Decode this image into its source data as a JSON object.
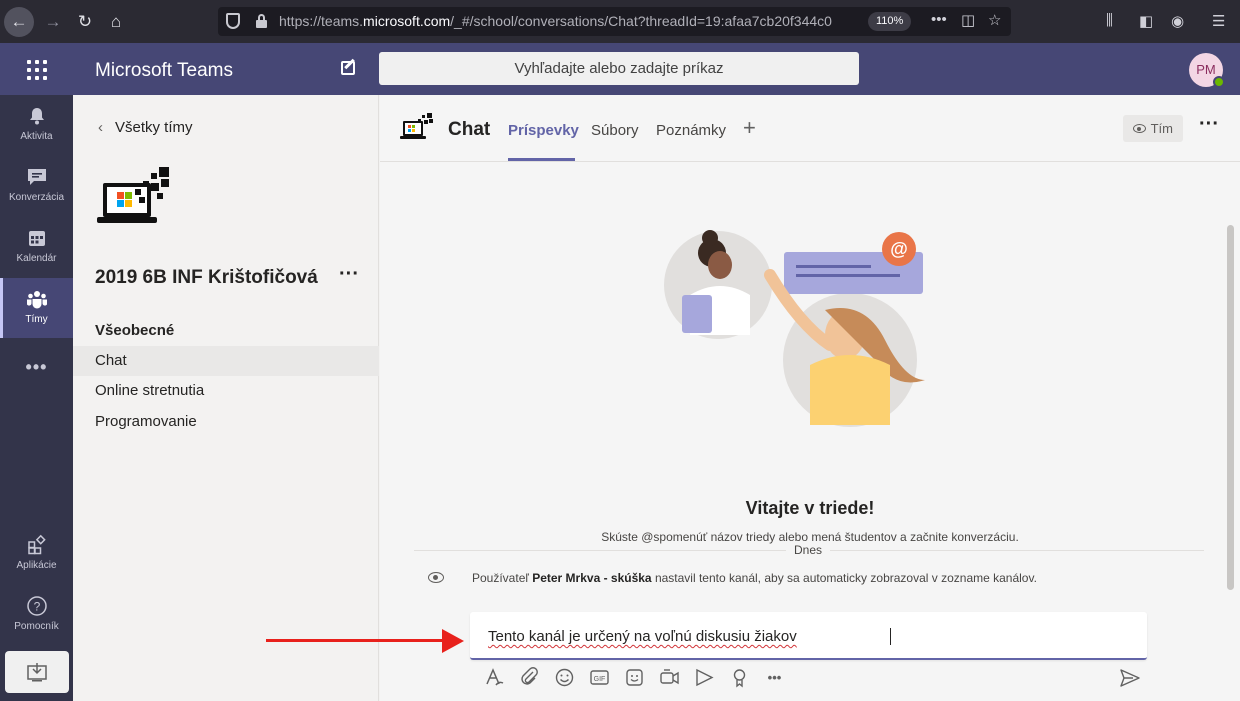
{
  "browser": {
    "url_prefix": "https://teams.",
    "url_domain": "microsoft.com",
    "url_rest": "/_#/school/conversations/Chat?threadId=19:afaa7cb20f344c0",
    "zoom": "110%"
  },
  "header": {
    "app_title": "Microsoft Teams",
    "search_placeholder": "Vyhľadajte alebo zadajte príkaz",
    "avatar_initials": "PM"
  },
  "rail": {
    "items": [
      {
        "label": "Aktivita",
        "icon": "bell-icon"
      },
      {
        "label": "Konverzácia",
        "icon": "chat-icon"
      },
      {
        "label": "Kalendár",
        "icon": "calendar-icon"
      },
      {
        "label": "Tímy",
        "icon": "teams-icon"
      },
      {
        "label": "Aplikácie",
        "icon": "apps-icon"
      },
      {
        "label": "Pomocník",
        "icon": "help-icon"
      }
    ]
  },
  "team_panel": {
    "back_label": "Všetky tímy",
    "team_name": "2019 6B INF Krištofičová",
    "section": "Všeobecné",
    "channels": [
      "Chat",
      "Online stretnutia",
      "Programovanie"
    ]
  },
  "main": {
    "channel_title": "Chat",
    "tabs": [
      "Príspevky",
      "Súbory",
      "Poznámky"
    ],
    "team_button": "Tím",
    "welcome_title": "Vitajte v triede!",
    "welcome_sub": "Skúste @spomenúť názov triedy alebo mená študentov a začnite konverzáciu.",
    "date_label": "Dnes",
    "sys_prefix": "Používateľ ",
    "sys_user": "Peter Mrkva - skúška",
    "sys_suffix": " nastavil tento kanál, aby sa automaticky zobrazoval v zozname kanálov.",
    "compose_text": "Tento kanál je určený na voľnú diskusiu žiakov"
  },
  "colors": {
    "brand": "#464775",
    "rail": "#33344a",
    "accent": "#6264a7",
    "annotation_arrow": "#e8211c"
  }
}
